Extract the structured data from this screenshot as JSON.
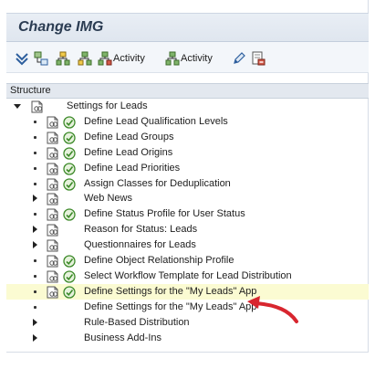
{
  "title": "Change IMG",
  "toolbar": {
    "activity1_label": "Activity",
    "activity2_label": "Activity"
  },
  "structure_header": "Structure",
  "tree": {
    "root_label": "Settings for Leads",
    "items": [
      {
        "label": "Define Lead Qualification Levels",
        "highlighted": false
      },
      {
        "label": "Define Lead Groups",
        "highlighted": false
      },
      {
        "label": "Define Lead Origins",
        "highlighted": false
      },
      {
        "label": "Define Lead Priorities",
        "highlighted": false
      },
      {
        "label": "Assign Classes for Deduplication",
        "highlighted": false
      },
      {
        "label": "Web News",
        "highlighted": false
      },
      {
        "label": "Define Status Profile for User Status",
        "highlighted": false
      },
      {
        "label": "Reason for Status: Leads",
        "highlighted": false
      },
      {
        "label": "Questionnaires for Leads",
        "highlighted": false
      },
      {
        "label": "Define Object Relationship Profile",
        "highlighted": false
      },
      {
        "label": "Select Workflow Template for Lead Distribution",
        "highlighted": false
      },
      {
        "label": "Define Settings for the \"My Leads\" App",
        "highlighted": true
      },
      {
        "label": "Define Settings for the \"My Leads\" App",
        "highlighted": false
      },
      {
        "label": "Rule-Based Distribution",
        "highlighted": false
      },
      {
        "label": "Business Add-Ins",
        "highlighted": false
      }
    ]
  },
  "colors": {
    "highlight": "#fbfbd2",
    "annotation_arrow": "#d8262f"
  }
}
